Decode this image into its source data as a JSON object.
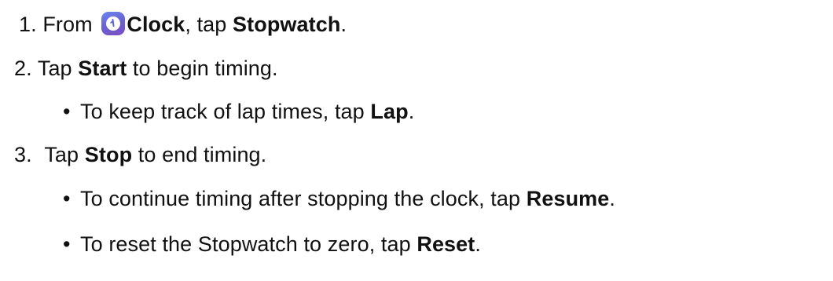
{
  "steps": [
    {
      "number": "1.",
      "parts": {
        "a": "From",
        "icon": "clock-app-icon",
        "b": "Clock",
        "c": ", tap",
        "d": "Stopwatch",
        "e": "."
      }
    },
    {
      "number": "2.",
      "parts": {
        "a": "Tap",
        "b": "Start",
        "c": "to begin timing."
      },
      "bullets": [
        {
          "a": "To keep track of lap times, tap",
          "b": "Lap",
          "c": "."
        }
      ]
    },
    {
      "number": "3.",
      "parts": {
        "a": "Tap",
        "b": "Stop",
        "c": "to end timing."
      },
      "bullets": [
        {
          "a": "To continue timing after stopping the clock, tap",
          "b": "Resume",
          "c": "."
        },
        {
          "a": "To reset the Stopwatch to zero, tap",
          "b": "Reset",
          "c": "."
        }
      ]
    }
  ],
  "bullet_symbol": "•",
  "colors": {
    "text": "#111111",
    "icon_gradient_start": "#6d86ec",
    "icon_gradient_end": "#7a4fc6"
  }
}
